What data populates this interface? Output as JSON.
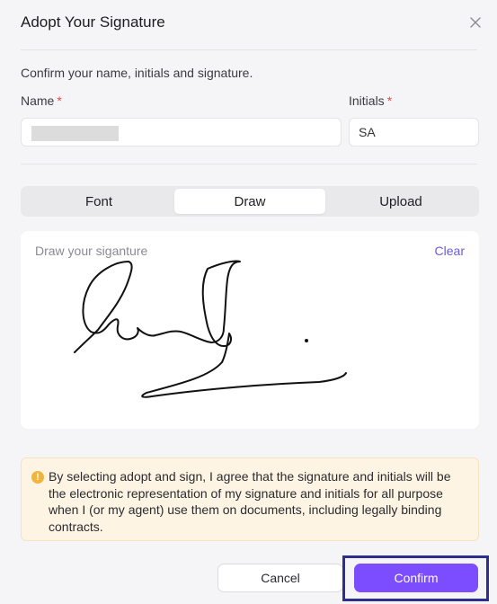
{
  "dialog": {
    "title": "Adopt Your Signature",
    "close_icon": "close-icon",
    "subtitle": "Confirm your name, initials and signature."
  },
  "form": {
    "name_label": "Name",
    "initials_label": "Initials",
    "required_mark": "*",
    "name_value": "",
    "initials_value": "SA"
  },
  "tabs": [
    {
      "label": "Font",
      "active": false
    },
    {
      "label": "Draw",
      "active": true
    },
    {
      "label": "Upload",
      "active": false
    }
  ],
  "signature_pad": {
    "placeholder": "Draw your siganture",
    "clear_label": "Clear"
  },
  "notice": {
    "icon": "warning-icon",
    "text": "By selecting adopt and sign, I agree that the signature and initials will be the electronic representation of my signature and initials for all purpose when I (or my agent) use them on documents, including legally binding contracts."
  },
  "actions": {
    "cancel_label": "Cancel",
    "confirm_label": "Confirm"
  },
  "colors": {
    "accent": "#7c4dff",
    "required": "#e34b4b",
    "link": "#6b5bd6",
    "notice_bg": "#fdf4e3",
    "warning": "#f2b43a"
  }
}
